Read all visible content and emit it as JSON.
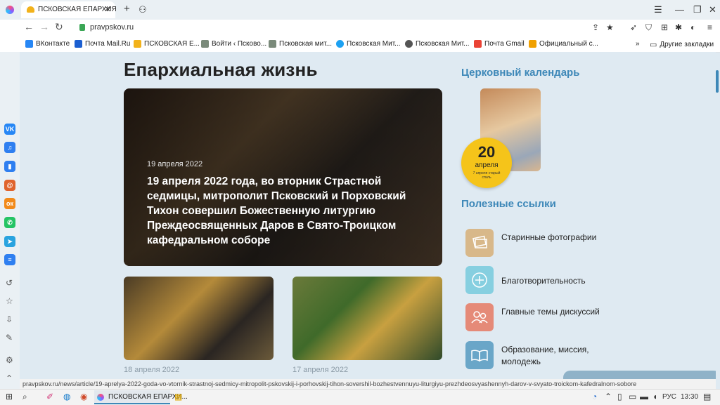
{
  "browser": {
    "tab_title": "ПСКОВСКАЯ ЕПАРХИЯ",
    "url": "pravpskov.ru",
    "bookmarks": [
      "ВКонтакте",
      "Почта Mail.Ru",
      "ПСКОВСКАЯ Е...",
      "Войти ‹ Псково...",
      "Псковская мит...",
      "Псковская Мит...",
      "Псковская Мит...",
      "Почта Gmail",
      "Официальный с..."
    ],
    "other_bookmarks": "Другие закладки",
    "more": "»"
  },
  "page": {
    "heading": "Епархиальная жизнь",
    "hero": {
      "date": "19 апреля 2022",
      "title": "19 апреля 2022 года, во вторник Страстной седмицы, митрополит Псковский и Порховский Тихон совершил Божественную литургию Преждеосвященных Даров в Свято-Троицком кафедральном соборе"
    },
    "cards": [
      {
        "date": "18 апреля 2022"
      },
      {
        "date": "17 апреля 2022"
      }
    ],
    "calendar": {
      "title": "Церковный календарь",
      "day": "20",
      "month": "апреля",
      "old_style": "7 апреля старый стиль"
    },
    "links_title": "Полезные ссылки",
    "links": [
      {
        "label": "Старинные фотографии",
        "color": "#d8b88a"
      },
      {
        "label": "Благотворительность",
        "color": "#86cfe0"
      },
      {
        "label": "Главные темы дискуссий",
        "color": "#e58a78"
      },
      {
        "label": "Образование, миссия, молодежь",
        "color": "#6aa6c8"
      }
    ]
  },
  "status_url": "pravpskov.ru/news/article/19-aprelya-2022-goda-vo-vtornik-strastnoj-sedmicy-mitropolit-pskovskij-i-porhovskij-tihon-sovershil-bozhestvennuyu-liturgiyu-prezhdeosvyashennyh-darov-v-svyato-troickom-kafedralnom-sobore",
  "taskbar": {
    "app_label": "ПСКОВСКАЯ ЕПАРХИ...",
    "lang": "РУС",
    "time": "13:30"
  }
}
